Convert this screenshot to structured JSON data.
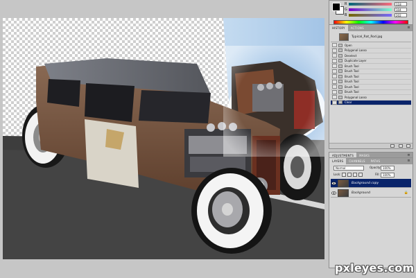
{
  "colors": {
    "fg": "#000000",
    "bg": "#ffffff",
    "selection": "#0a246a",
    "panel": "#d6d6d6",
    "sky": "#a8c8e8",
    "road": "#3c3c3c"
  },
  "color_panel": {
    "rows": [
      {
        "label": "R",
        "value": "118"
      },
      {
        "label": "G",
        "value": "104"
      },
      {
        "label": "B",
        "value": "202"
      }
    ]
  },
  "history": {
    "tabs": [
      "HISTORY",
      "ACTIONS"
    ],
    "snapshot": "Typical_Rat_Rod.jpg",
    "items": [
      "Open",
      "Polygonal Lasso",
      "Deselect",
      "Duplicate Layer",
      "Brush Tool",
      "Brush Tool",
      "Brush Tool",
      "Brush Tool",
      "Brush Tool",
      "Brush Tool",
      "Polygonal Lasso",
      "Clear"
    ],
    "selected_index": 11
  },
  "adjustments": {
    "tabs": [
      "ADJUSTMENTS",
      "MASKS"
    ]
  },
  "layers": {
    "tabs": [
      "LAYERS",
      "CHANNELS",
      "PATHS"
    ],
    "blend_mode": "Normal",
    "opacity_label": "Opacity:",
    "opacity": "100%",
    "lock_label": "Lock:",
    "fill_label": "Fill:",
    "fill": "100%",
    "items": [
      {
        "name": "Background copy",
        "selected": true
      },
      {
        "name": "Background",
        "selected": false
      }
    ]
  },
  "watermark": "pxleyes.com"
}
